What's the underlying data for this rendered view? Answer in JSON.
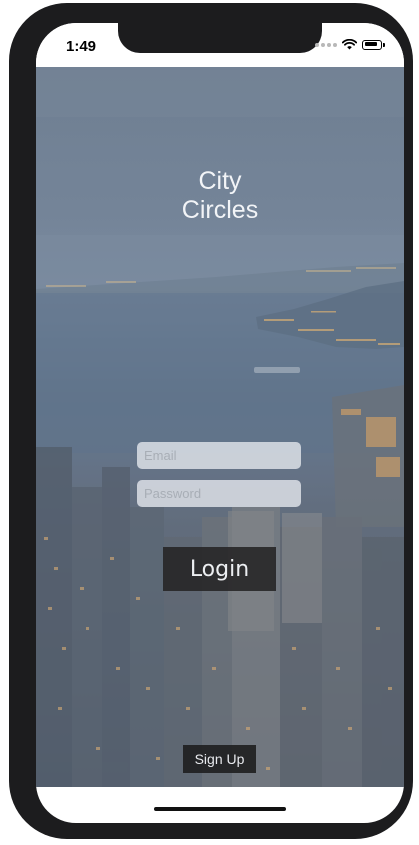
{
  "status_bar": {
    "time": "1:49"
  },
  "app": {
    "title_line1": "City",
    "title_line2": "Circles",
    "email_placeholder": "Email",
    "password_placeholder": "Password",
    "login_label": "Login",
    "signup_label": "Sign Up"
  },
  "colors": {
    "frame": "#1c1c1e",
    "button_bg": "#242324",
    "field_bg": "#e0e4ea",
    "title_text": "#f2f4f7"
  },
  "icons": [
    "wifi-icon",
    "battery-icon",
    "cellular-signal-icon"
  ]
}
